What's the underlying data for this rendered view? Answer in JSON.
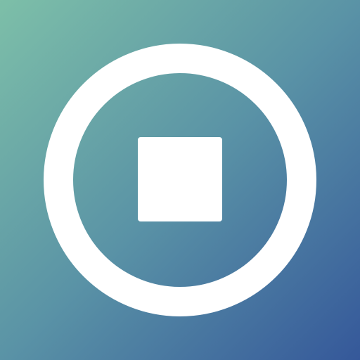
{
  "app_icon": {
    "icon_name": "stop-circle-icon",
    "colors": {
      "gradient_start": "#7dbfa8",
      "gradient_end": "#35589a",
      "glyph": "#ffffff"
    }
  }
}
